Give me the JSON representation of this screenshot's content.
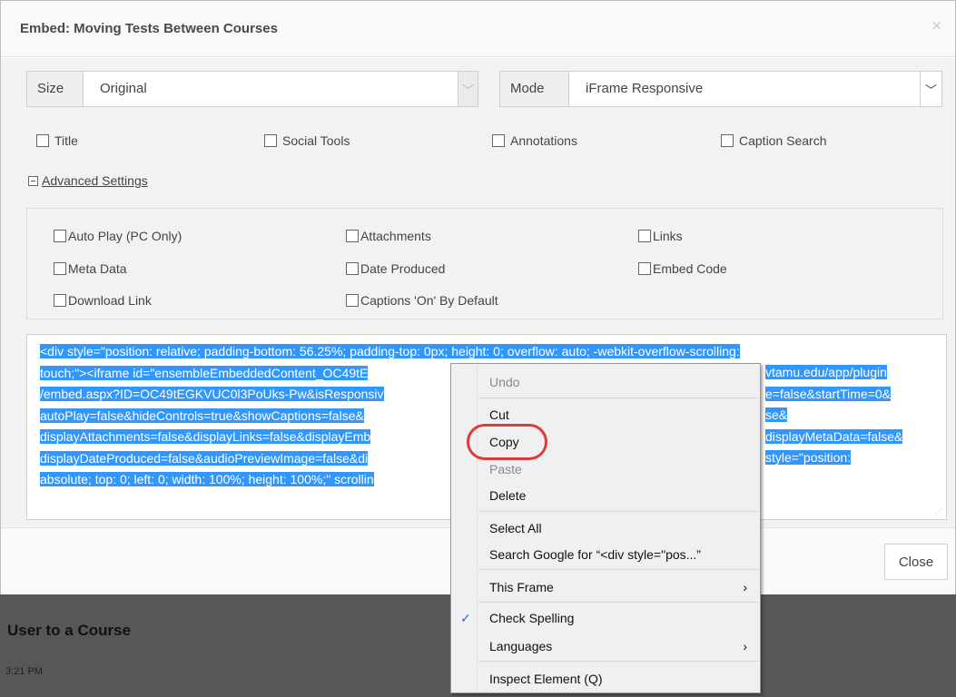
{
  "dialog": {
    "title": "Embed: Moving Tests Between Courses",
    "close_symbol": "×",
    "size": {
      "label": "Size",
      "value": "Original"
    },
    "mode": {
      "label": "Mode",
      "value": "iFrame Responsive"
    },
    "options": [
      "Title",
      "Social Tools",
      "Annotations",
      "Caption Search"
    ],
    "advanced_label": "Advanced Settings",
    "advanced": [
      "Auto Play (PC Only)",
      "Attachments",
      "Links",
      "Meta Data",
      "Date Produced",
      "Embed Code",
      "Download Link",
      "Captions 'On' By Default"
    ],
    "code_lines": [
      "<div style=\"position: relative; padding-bottom: 56.25%; padding-top: 0px; height: 0; overflow: auto; -webkit-overflow-scrolling:",
      "touch;\"><iframe id=\"ensembleEmbeddedContent_OC49tE",
      "/embed.aspx?ID=OC49tEGKVUC0l3PoUks-Pw&isResponsiv",
      "autoPlay=false&hideControls=true&showCaptions=false&",
      "displayAttachments=false&displayLinks=false&displayEmb",
      "displayDateProduced=false&audioPreviewImage=false&di",
      "absolute; top: 0; left: 0; width: 100%; height: 100%;\" scrollin"
    ],
    "code_tails": [
      "vtamu.edu/app/plugin",
      "e=false&startTime=0&",
      "se&",
      "displayMetaData=false&",
      "style=\"position:"
    ],
    "close_button": "Close"
  },
  "context_menu": {
    "items": [
      "Undo",
      "Cut",
      "Copy",
      "Paste",
      "Delete",
      "Select All",
      "Search Google for “<div style=\"pos...”",
      "This Frame",
      "Check Spelling",
      "Languages",
      "Inspect Element (Q)"
    ],
    "submenu_arrow": "›",
    "checkmark": "✓"
  },
  "background": {
    "title": "User to a Course",
    "time": "3:21 PM"
  },
  "colors": {
    "selection": "#3297fd",
    "highlight_ring": "#e0393e"
  }
}
